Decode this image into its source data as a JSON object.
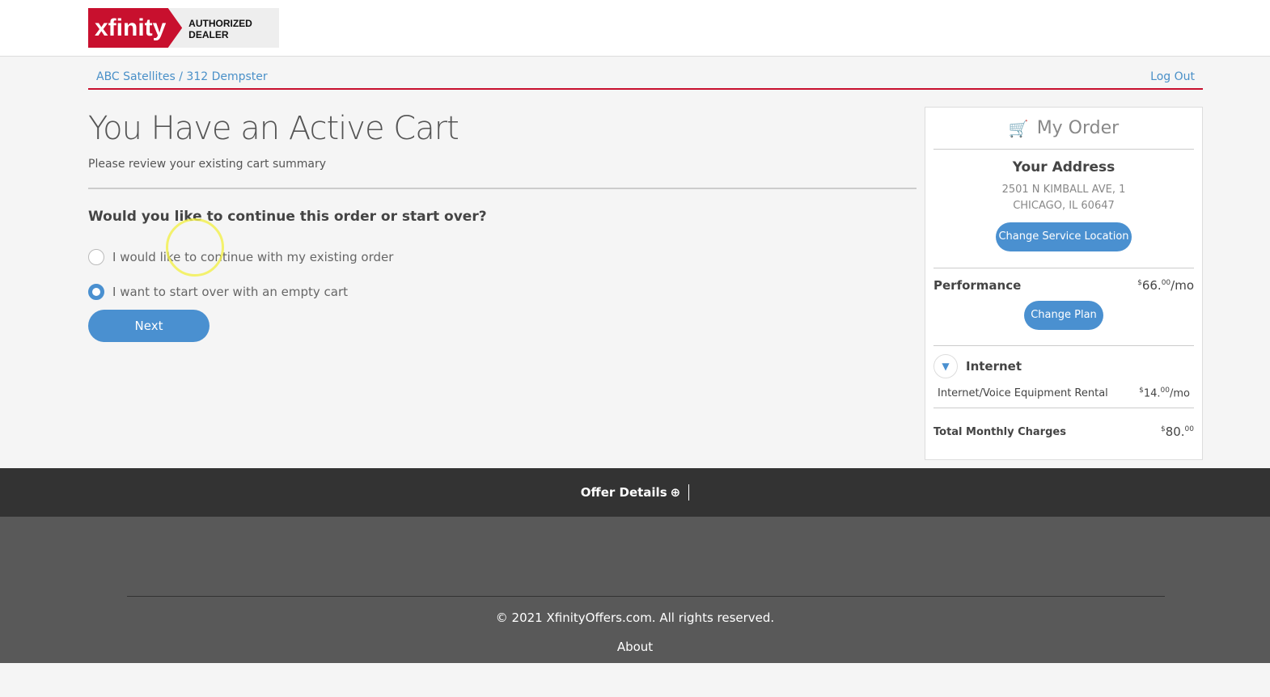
{
  "logo": {
    "brand": "xfinity",
    "tag": "AUTHORIZED DEALER"
  },
  "breadcrumb": "ABC Satellites / 312 Dempster",
  "logout": "Log Out",
  "title": "You Have an Active Cart",
  "subtitle": "Please review your existing cart summary",
  "question": "Would you like to continue this order or start over?",
  "options": [
    {
      "label": "I would like to continue with my existing order",
      "selected": false
    },
    {
      "label": "I want to start over with an empty cart",
      "selected": true
    }
  ],
  "next": "Next",
  "order": {
    "title": "My Order",
    "address_title": "Your Address",
    "address_line1": "2501 N KIMBALL AVE, 1",
    "address_line2": "CHICAGO, IL 60647",
    "change_location": "Change Service Location",
    "plan": "Performance",
    "plan_price": "66.",
    "plan_cents": "00",
    "per_mo": "/mo",
    "change_plan": "Change Plan",
    "section": "Internet",
    "item": "Internet/Voice Equipment Rental",
    "item_price": "14.",
    "item_cents": "00",
    "total_label": "Total Monthly Charges",
    "total": "80.",
    "total_cents": "00",
    "currency": "$"
  },
  "offer_details": "Offer Details",
  "copyright": "© 2021 XfinityOffers.com. All rights reserved.",
  "about": "About"
}
